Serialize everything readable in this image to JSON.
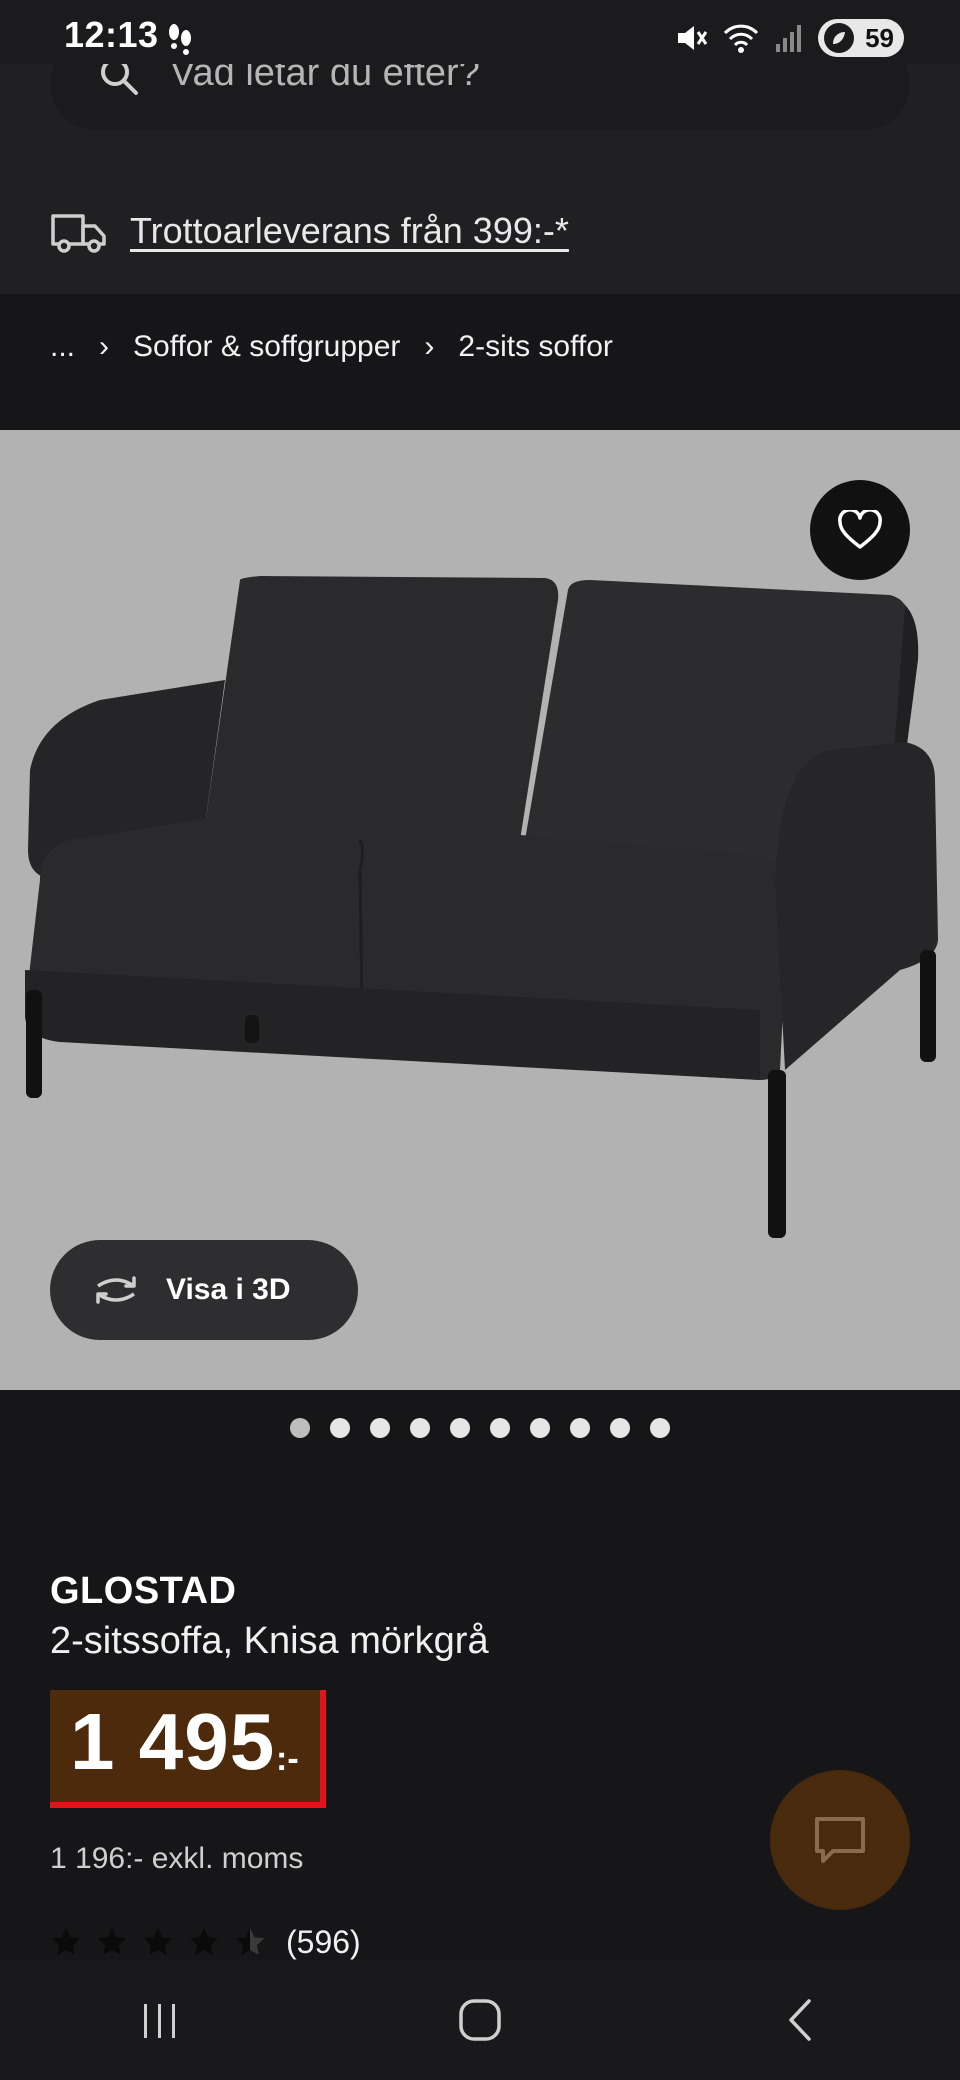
{
  "status_bar": {
    "time": "12:13",
    "battery": "59"
  },
  "search": {
    "placeholder": "Vad letar du efter?"
  },
  "delivery": {
    "text": "Trottoarleverans från 399:-*"
  },
  "breadcrumb": {
    "items": [
      "...",
      "Soffor & soffgrupper",
      "2-sits soffor"
    ]
  },
  "product": {
    "visa3d_label": "Visa i 3D",
    "brand": "GLOSTAD",
    "description": "2-sitssoffa, Knisa mörkgrå",
    "price": "1 495",
    "price_suffix": ":-",
    "price_ex_vat": "1 196:- exkl. moms",
    "rating": 4.5,
    "reviews": "(596)"
  },
  "carousel": {
    "count": 10,
    "active": 0
  },
  "colors": {
    "price_bg": "#4e2a0c",
    "price_accent": "#e4121a",
    "background": "#161618"
  },
  "icons": [
    "search-icon",
    "truck-icon",
    "heart-icon",
    "rotate-3d-icon",
    "chat-icon",
    "recents-icon",
    "home-icon",
    "back-icon"
  ]
}
